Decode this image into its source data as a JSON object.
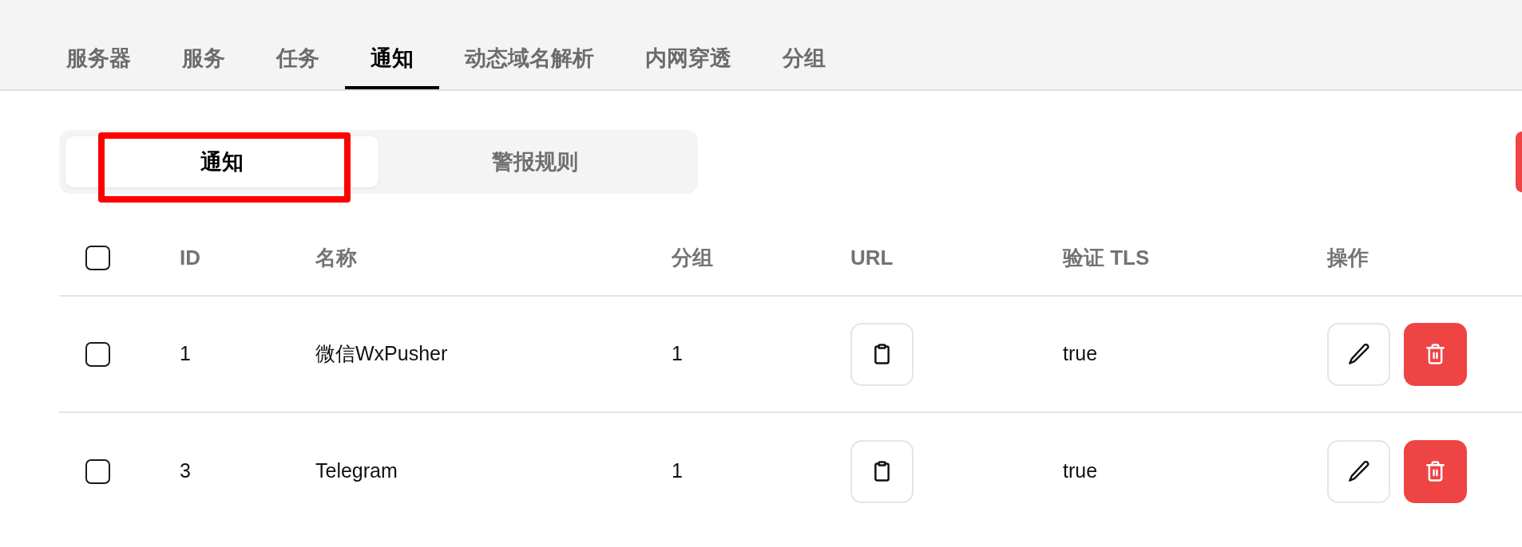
{
  "nav_tabs": [
    {
      "label": "服务器",
      "selected": false
    },
    {
      "label": "服务",
      "selected": false
    },
    {
      "label": "任务",
      "selected": false
    },
    {
      "label": "通知",
      "selected": true
    },
    {
      "label": "动态域名解析",
      "selected": false
    },
    {
      "label": "内网穿透",
      "selected": false
    },
    {
      "label": "分组",
      "selected": false
    }
  ],
  "sub_tabs": [
    {
      "label": "通知",
      "selected": true,
      "highlighted": true
    },
    {
      "label": "警报规则",
      "selected": false,
      "highlighted": false
    }
  ],
  "table": {
    "select_all": {
      "checked": false
    },
    "columns": [
      "ID",
      "名称",
      "分组",
      "URL",
      "验证 TLS",
      "操作"
    ],
    "rows": [
      {
        "checked": false,
        "id": "1",
        "name": "微信WxPusher",
        "group": "1",
        "verify_tls": "true"
      },
      {
        "checked": false,
        "id": "3",
        "name": "Telegram",
        "group": "1",
        "verify_tls": "true"
      }
    ]
  }
}
